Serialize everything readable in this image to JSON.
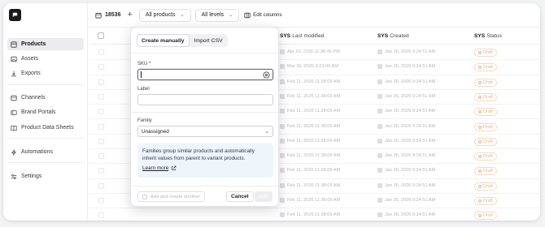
{
  "sidebar": {
    "items": [
      {
        "label": "Products",
        "icon": "products-icon",
        "active": true
      },
      {
        "label": "Assets",
        "icon": "image-icon"
      },
      {
        "label": "Exports",
        "icon": "download-icon"
      },
      {
        "label": "Channels",
        "icon": "channels-icon"
      },
      {
        "label": "Brand Portals",
        "icon": "portal-icon"
      },
      {
        "label": "Product Data Sheets",
        "icon": "book-icon"
      },
      {
        "label": "Automations",
        "icon": "bolt-icon"
      },
      {
        "label": "Settings",
        "icon": "sliders-icon"
      }
    ]
  },
  "topbar": {
    "product_count": "18536",
    "all_products": "All products",
    "all_levels": "All levels",
    "edit_columns": "Edit columns"
  },
  "table": {
    "columns": [
      {
        "prefix": "SYS",
        "label": "Last modified"
      },
      {
        "prefix": "SYS",
        "label": "Created"
      },
      {
        "prefix": "SYS",
        "label": "Status"
      }
    ],
    "rows": [
      {
        "modified": "Apr 10, 2026 11:36:46 PM",
        "created": "Jan 26, 2026 9:24:51 AM",
        "status": "Draft"
      },
      {
        "modified": "Mar 26, 2026 9:23:06 AM",
        "created": "Jan 26, 2026 9:24:51 AM",
        "status": "Draft"
      },
      {
        "modified": "Feb 11, 2026 11:38:09 AM",
        "created": "Jan 26, 2026 9:24:51 AM",
        "status": "Draft"
      },
      {
        "modified": "Feb 11, 2026 11:38:09 AM",
        "created": "Jan 26, 2026 9:24:51 AM",
        "status": "Draft"
      },
      {
        "modified": "Feb 11, 2026 11:38:09 AM",
        "created": "Jan 26, 2026 9:24:51 AM",
        "status": "Draft"
      },
      {
        "modified": "Feb 11, 2026 11:38:09 AM",
        "created": "Jan 26, 2026 9:24:51 AM",
        "status": "Draft"
      },
      {
        "modified": "Feb 11, 2026 11:38:09 AM",
        "created": "Jan 26, 2026 9:24:51 AM",
        "status": "Draft"
      },
      {
        "modified": "Feb 11, 2026 11:38:09 AM",
        "created": "Jan 26, 2026 9:24:51 AM",
        "status": "Draft"
      },
      {
        "modified": "Feb 11, 2026 11:38:09 AM",
        "created": "Jan 26, 2026 9:24:51 AM",
        "status": "Draft"
      },
      {
        "modified": "Feb 11, 2026 11:38:09 AM",
        "created": "Jan 26, 2026 9:24:51 AM",
        "status": "Draft"
      },
      {
        "modified": "Feb 11, 2026 11:38:09 AM",
        "created": "Jan 26, 2026 9:24:51 AM",
        "status": "Draft"
      },
      {
        "modified": "Feb 11, 2026 11:38:09 AM",
        "created": "Jan 26, 2026 9:24:51 AM",
        "status": "Draft"
      }
    ]
  },
  "modal": {
    "tabs": [
      "Create manually",
      "Import CSV"
    ],
    "sku_label": "SKU *",
    "sku_value": "",
    "label_label": "Label",
    "label_value": "",
    "family_label": "Family",
    "family_value": "Unassigned",
    "info_text": "Families group similar products and automatically inherit values from parent to variant products.",
    "learn_more": "Learn more",
    "add_create_another": "Add and create another",
    "cancel": "Cancel",
    "add": "Add"
  },
  "colors": {
    "accent": "#1b1b1f",
    "draft": "#e7b48e",
    "info_bg": "#eef5fb"
  }
}
